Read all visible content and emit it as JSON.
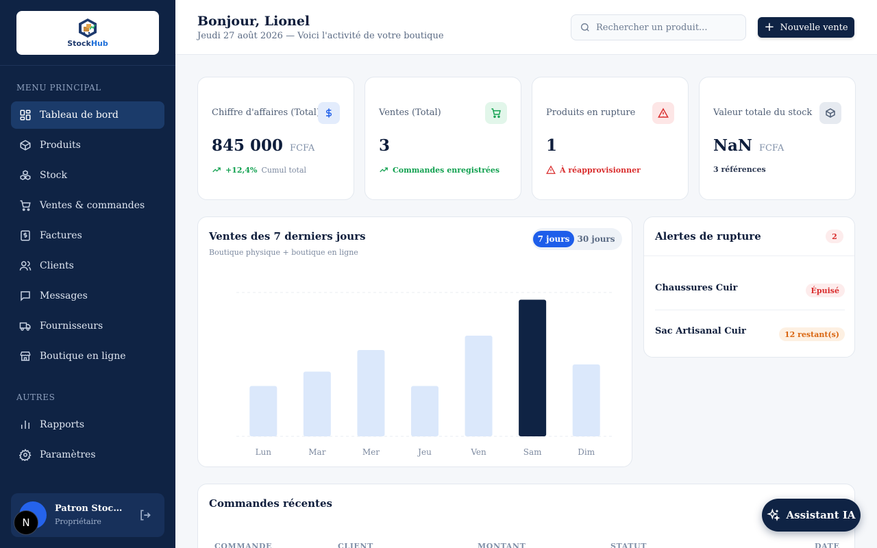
{
  "brand": {
    "name_part1": "Stock",
    "name_part2": "Hub"
  },
  "sidebar": {
    "main_section": "MENU PRINCIPAL",
    "main_items": [
      {
        "label": "Tableau de bord",
        "icon": "dashboard-icon",
        "active": true
      },
      {
        "label": "Produits",
        "icon": "box-icon"
      },
      {
        "label": "Stock",
        "icon": "stock-boxes-icon"
      },
      {
        "label": "Ventes & commandes",
        "icon": "cart-icon"
      },
      {
        "label": "Factures",
        "icon": "invoice-icon"
      },
      {
        "label": "Clients",
        "icon": "users-icon"
      },
      {
        "label": "Messages",
        "icon": "message-icon"
      },
      {
        "label": "Fournisseurs",
        "icon": "truck-icon"
      },
      {
        "label": "Boutique en ligne",
        "icon": "store-icon"
      }
    ],
    "other_section": "AUTRES",
    "other_items": [
      {
        "label": "Rapports",
        "icon": "chart-icon"
      },
      {
        "label": "Paramètres",
        "icon": "gear-icon"
      }
    ],
    "user": {
      "name": "Patron Stock…",
      "role": "Propriétaire"
    },
    "dev_badge": "N"
  },
  "header": {
    "greeting": "Bonjour, Lionel",
    "subtitle": "Jeudi 27 août 2026 — Voici l'activité de votre boutique",
    "search_placeholder": "Rechercher un produit...",
    "new_sale_label": "Nouvelle vente"
  },
  "kpis": [
    {
      "title": "Chiffre d'affaires (Total)",
      "value": "845 000",
      "unit": "FCFA",
      "foot_strong": "+12,4%",
      "foot_light": "Cumul total",
      "icon": "dollar-icon",
      "accent": "#1e5eea",
      "icon_bg": "#e3ecfc",
      "foot_color": "#12a150"
    },
    {
      "title": "Ventes (Total)",
      "value": "3",
      "unit": "",
      "foot_strong": "Commandes enregistrées",
      "foot_light": "",
      "icon": "cart-icon",
      "accent": "#12a150",
      "icon_bg": "#e2f6ea",
      "foot_color": "#12a150"
    },
    {
      "title": "Produits en rupture",
      "value": "1",
      "unit": "",
      "foot_strong": "À réapprovisionner",
      "foot_light": "",
      "icon": "warning-icon",
      "accent": "#d92d2d",
      "icon_bg": "#fde6e6",
      "foot_color": "#d92d2d"
    },
    {
      "title": "Valeur totale du stock",
      "value": "NaN",
      "unit": "FCFA",
      "foot_strong": "3 références",
      "foot_light": "",
      "icon": "box-icon",
      "accent": "#4f5e75",
      "icon_bg": "#e6eaf0",
      "foot_color": "#2a3650"
    }
  ],
  "chart_panel": {
    "title": "Ventes des 7 derniers jours",
    "subtitle": "Boutique physique + boutique en ligne",
    "toggle_on": "7 jours",
    "toggle_off": "30 jours"
  },
  "chart_data": {
    "type": "bar",
    "categories": [
      "Lun",
      "Mar",
      "Mer",
      "Jeu",
      "Ven",
      "Sam",
      "Dim"
    ],
    "values": [
      35,
      45,
      60,
      35,
      70,
      95,
      50
    ],
    "ylim": [
      0,
      100
    ],
    "highlight_index": 5,
    "bar_color": "#dbe8fb",
    "highlight_color": "#0f2344",
    "grid": true
  },
  "alerts": {
    "title": "Alertes de rupture",
    "count": "2",
    "items": [
      {
        "name": "Chaussures Cuir",
        "tag": "Épuisé",
        "tag_color": "#d92d2d",
        "tag_bg": "#fdecec"
      },
      {
        "name": "Sac Artisanal Cuir",
        "tag": "12 restant(s)",
        "tag_color": "#d9650f",
        "tag_bg": "#fdf0e2"
      }
    ]
  },
  "orders": {
    "title": "Commandes récentes",
    "columns": [
      "COMMANDE",
      "CLIENT",
      "MONTANT",
      "STATUT",
      "DATE"
    ]
  },
  "assistant_label": "Assistant IA"
}
